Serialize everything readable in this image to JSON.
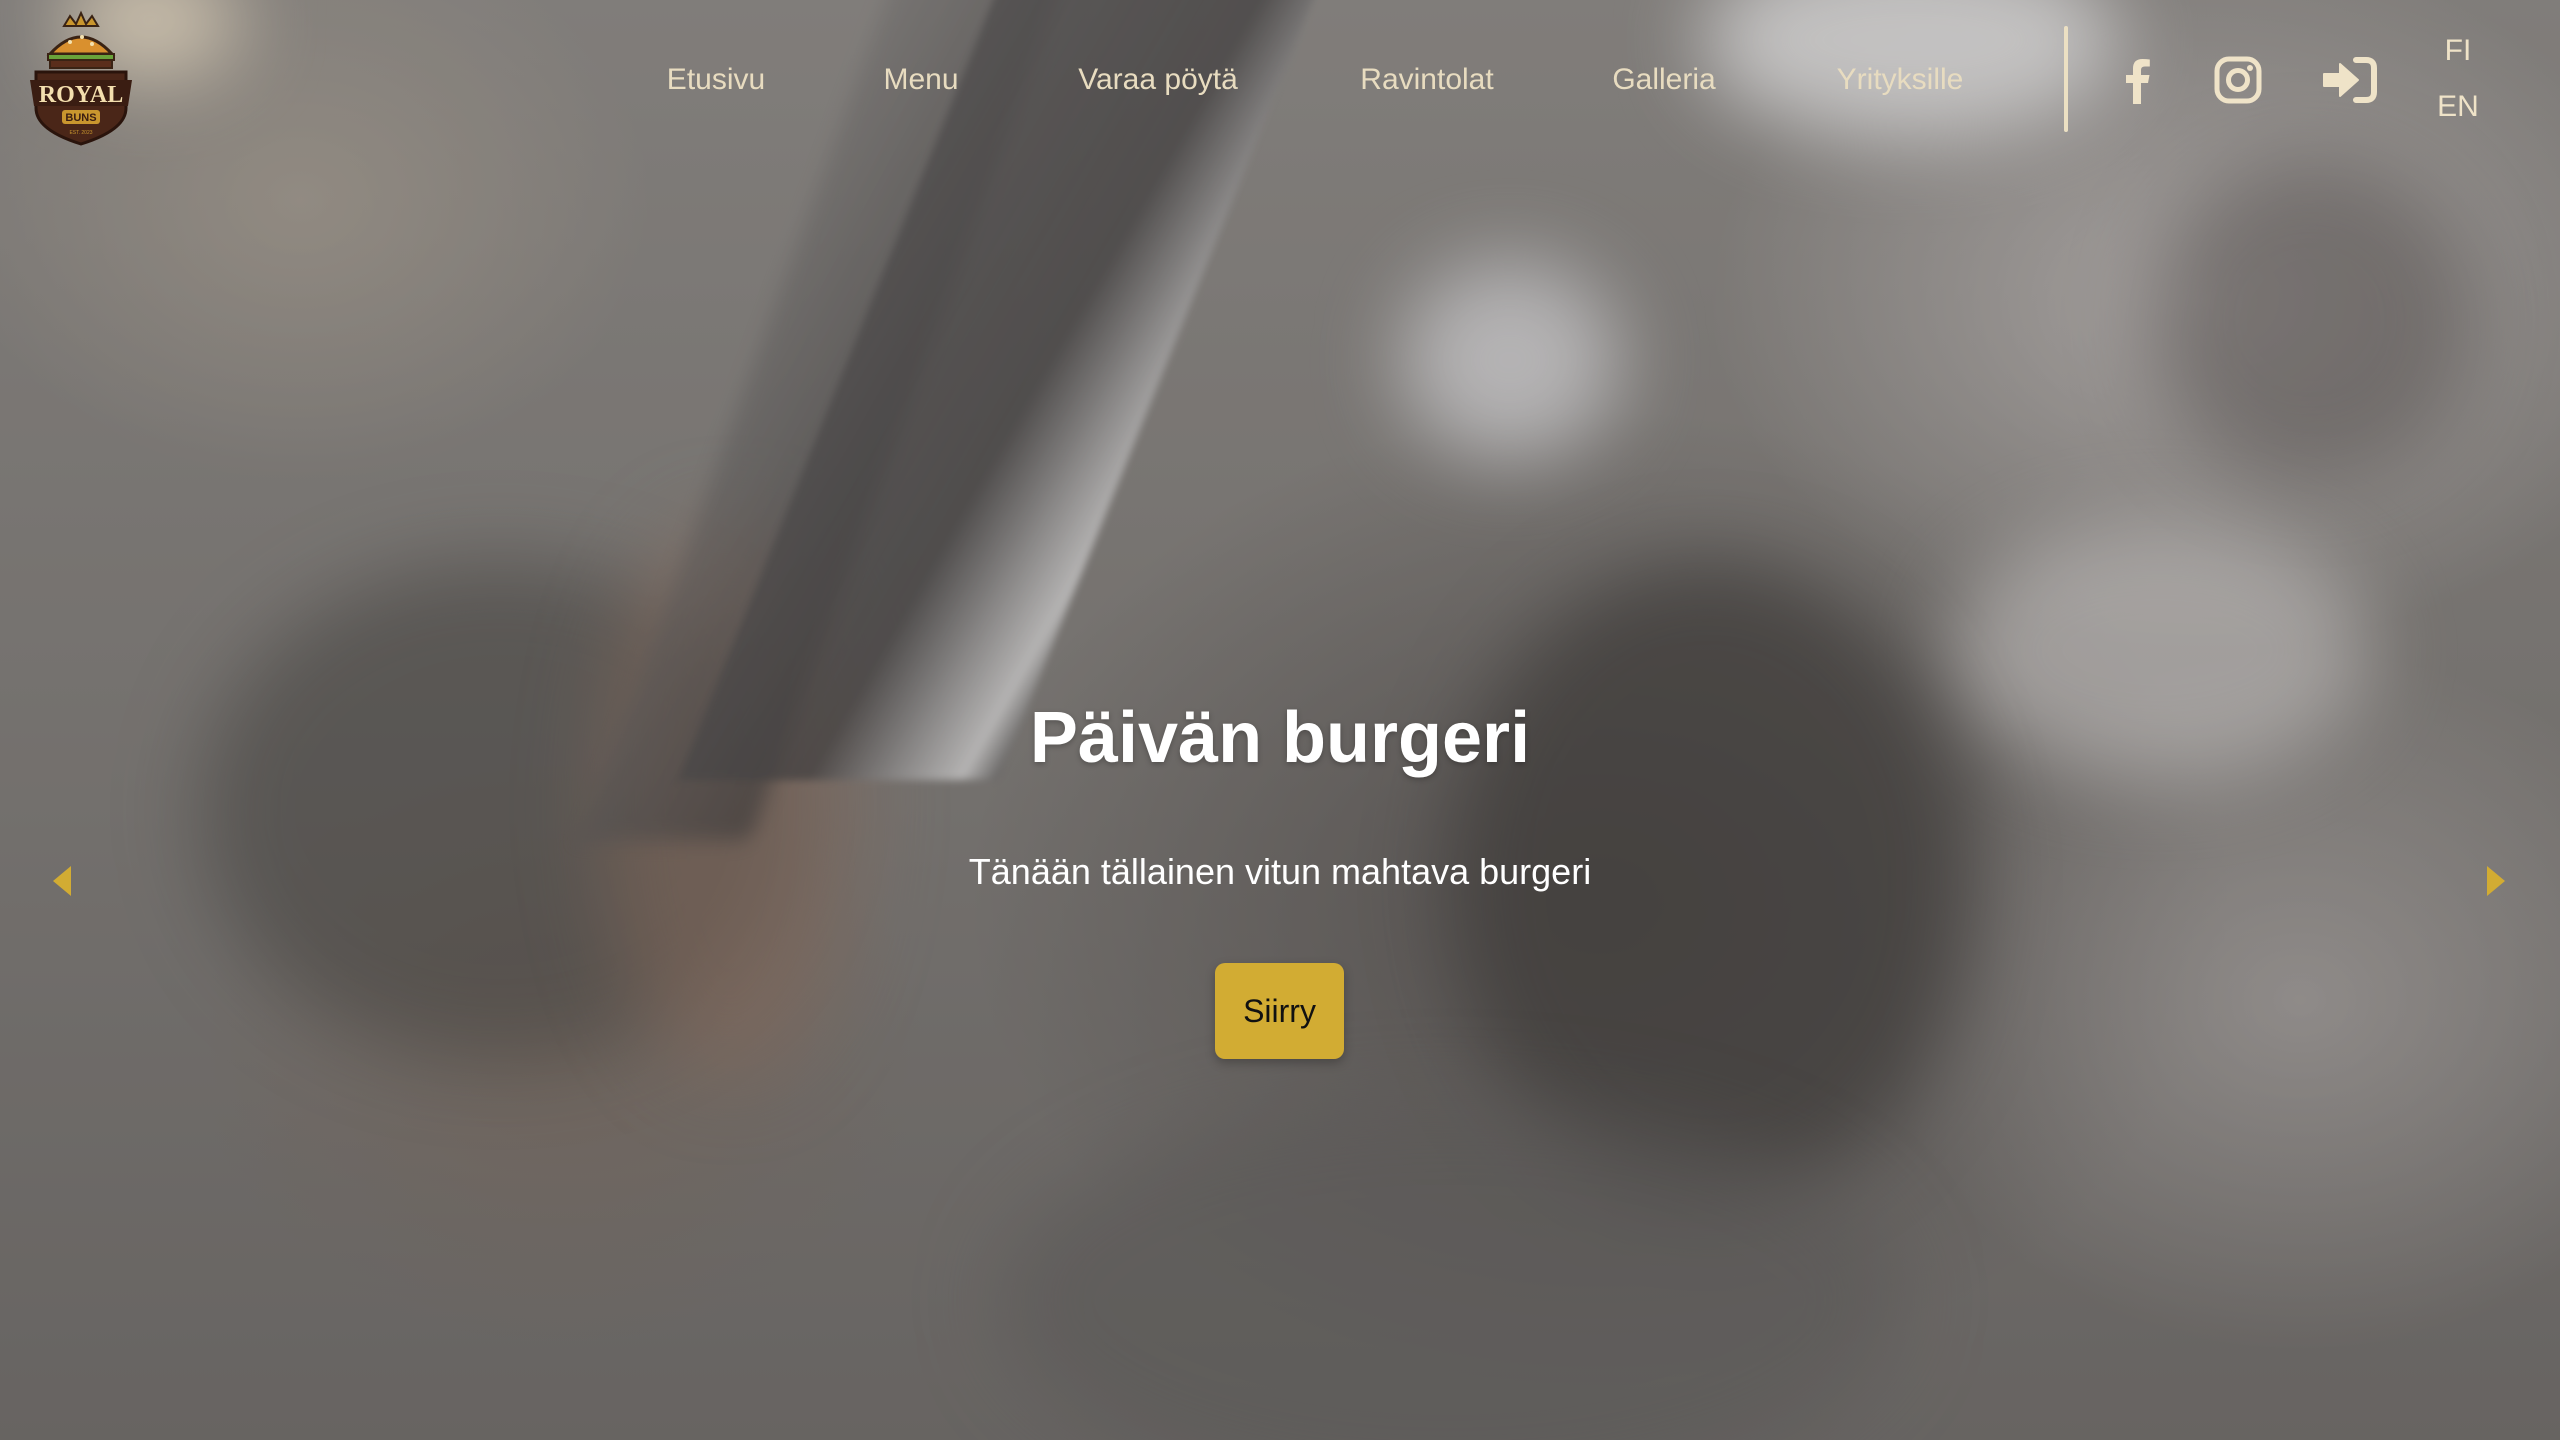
{
  "brand": {
    "name": "ROYAL",
    "sub": "BUNS",
    "tiny": "EST. 2023",
    "colors": {
      "accent": "#d2ac33",
      "nav_text": "#e8dcc0",
      "button_text": "#111111"
    }
  },
  "nav": {
    "items": [
      {
        "label": "Etusivu"
      },
      {
        "label": "Menu"
      },
      {
        "label": "Varaa pöytä"
      },
      {
        "label": "Ravintolat"
      },
      {
        "label": "Galleria"
      },
      {
        "label": "Yrityksille"
      }
    ]
  },
  "social": {
    "facebook_icon": "facebook-icon",
    "instagram_icon": "instagram-icon",
    "login_icon": "sign-in-icon"
  },
  "lang": {
    "fi": "FI",
    "en": "EN"
  },
  "hero": {
    "title": "Päivän burgeri",
    "subtitle": "Tänään tällainen vitun mahtava burgeri",
    "button_label": "Siirry"
  },
  "carousel": {
    "prev_icon": "caret-left-icon",
    "next_icon": "caret-right-icon"
  }
}
